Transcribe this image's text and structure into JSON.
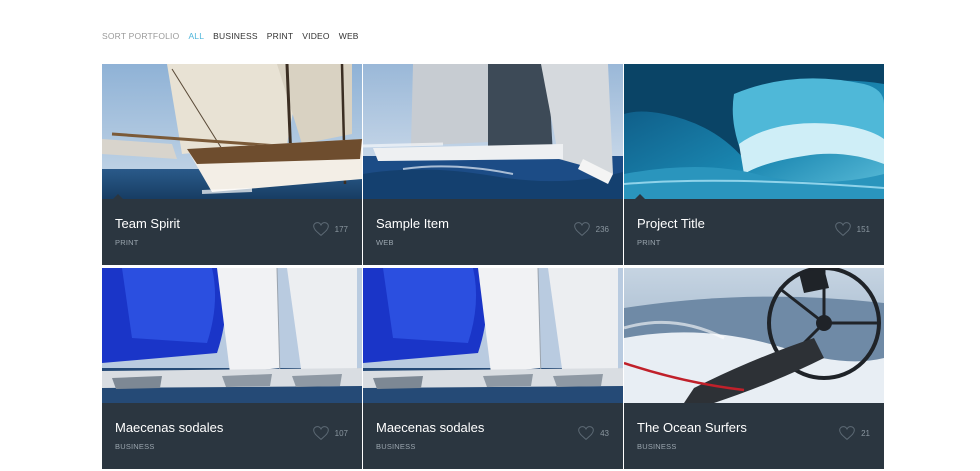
{
  "filter": {
    "label": "SORT PORTFOLIO",
    "items": [
      "ALL",
      "BUSINESS",
      "PRINT",
      "VIDEO",
      "WEB"
    ],
    "active": "ALL",
    "accent_color": "#4fb6da"
  },
  "cards": [
    {
      "title": "Team Spirit",
      "category": "PRINT",
      "likes": "177",
      "image": "classic-sailboat"
    },
    {
      "title": "Sample Item",
      "category": "WEB",
      "likes": "236",
      "image": "racing-yacht"
    },
    {
      "title": "Project Title",
      "category": "PRINT",
      "likes": "151",
      "image": "ocean-wave"
    },
    {
      "title": "Maecenas sodales",
      "category": "BUSINESS",
      "likes": "107",
      "image": "blue-spinnaker"
    },
    {
      "title": "Maecenas sodales",
      "category": "BUSINESS",
      "likes": "43",
      "image": "blue-spinnaker"
    },
    {
      "title": "The Ocean Surfers",
      "category": "BUSINESS",
      "likes": "21",
      "image": "helm-wheel"
    }
  ],
  "colors": {
    "card_bg": "#2b3640",
    "title": "#ffffff",
    "muted": "#9aa5ae"
  }
}
